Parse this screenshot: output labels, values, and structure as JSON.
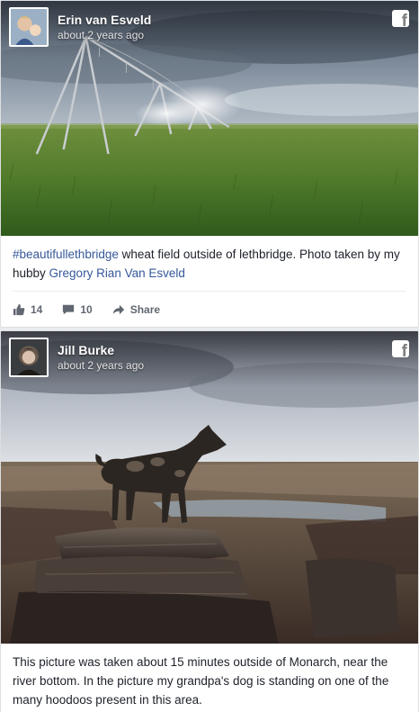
{
  "posts": [
    {
      "author": "Erin van Esveld",
      "timestamp": "about 2 years ago",
      "source_icon": "facebook-icon",
      "caption": {
        "hashtag": "#beautifullethbridge",
        "text": " wheat field outside of lethbridge. Photo taken by my hubby ",
        "mention": "Gregory Rian Van Esveld"
      },
      "stats": {
        "likes": "14",
        "comments": "10",
        "share_label": "Share"
      }
    },
    {
      "author": "Jill Burke",
      "timestamp": "about 2 years ago",
      "source_icon": "facebook-icon",
      "caption": {
        "text": "This picture was taken about 15 minutes outside of Monarch, near the river bottom. In the picture my grandpa's dog is standing on one of the many hoodoos present in this area."
      }
    }
  ],
  "colors": {
    "link": "#365899",
    "meta": "#606770",
    "text": "#1d2129"
  }
}
